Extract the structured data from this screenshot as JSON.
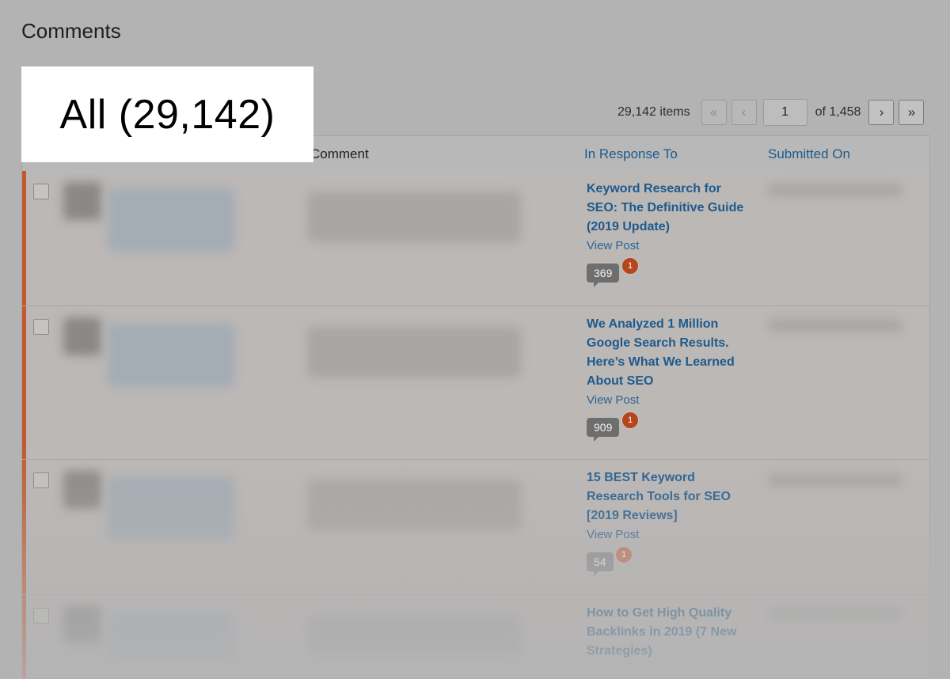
{
  "page": {
    "title": "Comments"
  },
  "filter": {
    "all_label": "All (29,142)"
  },
  "pagination": {
    "items_label": "29,142 items",
    "first_icon": "«",
    "prev_icon": "‹",
    "current_page": "1",
    "of_label": "of 1,458",
    "next_icon": "›",
    "last_icon": "»"
  },
  "table": {
    "headers": {
      "comment": "Comment",
      "response": "In Response To",
      "submitted": "Submitted On"
    },
    "rows": [
      {
        "post_title": "Keyword Research for SEO: The Definitive Guide (2019 Update)",
        "view_post": "View Post",
        "comment_count": "369",
        "pending_count": "1"
      },
      {
        "post_title": "We Analyzed 1 Million Google Search Results. Here’s What We Learned About SEO",
        "view_post": "View Post",
        "comment_count": "909",
        "pending_count": "1"
      },
      {
        "post_title": "15 BEST Keyword Research Tools for SEO [2019 Reviews]",
        "view_post": "View Post",
        "comment_count": "54",
        "pending_count": "1"
      },
      {
        "post_title": "How to Get High Quality Backlinks in 2019 (7 New Strategies)"
      }
    ]
  },
  "colors": {
    "accent_edge": "#c25a2e",
    "link": "#1d5a8c",
    "badge": "#b5451b"
  }
}
